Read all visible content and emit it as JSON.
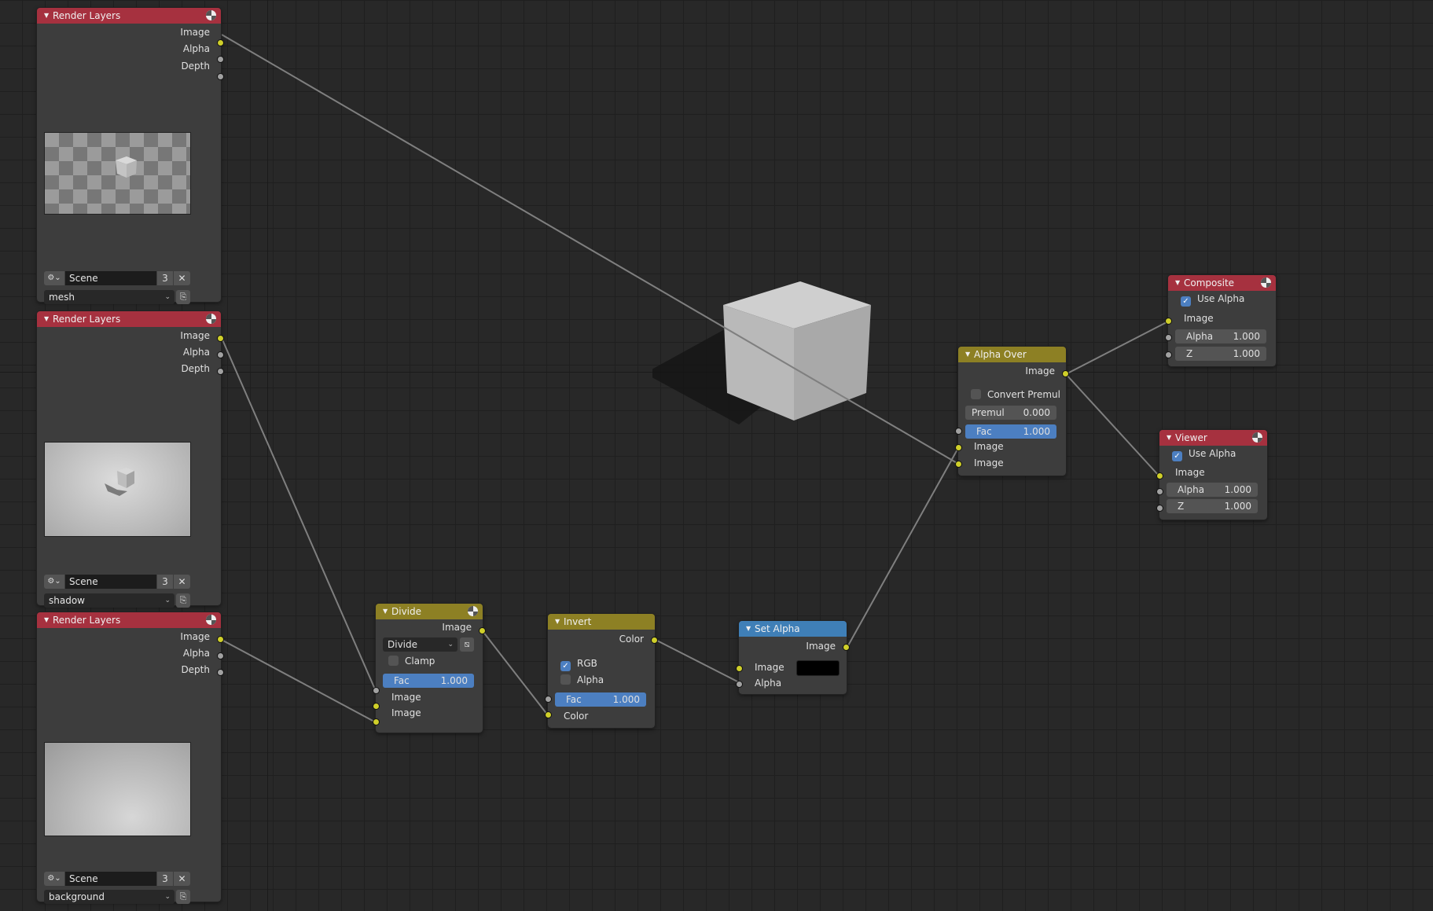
{
  "nodes": {
    "render_layers_mesh": {
      "title": "Render Layers",
      "outputs": [
        "Image",
        "Alpha",
        "Depth"
      ],
      "scene": "Scene",
      "scene_users": "3",
      "layer": "mesh"
    },
    "render_layers_shadow": {
      "title": "Render Layers",
      "outputs": [
        "Image",
        "Alpha",
        "Depth"
      ],
      "scene": "Scene",
      "scene_users": "3",
      "layer": "shadow"
    },
    "render_layers_background": {
      "title": "Render Layers",
      "outputs": [
        "Image",
        "Alpha",
        "Depth"
      ],
      "scene": "Scene",
      "scene_users": "3",
      "layer": "background"
    },
    "divide": {
      "title": "Divide",
      "output": "Image",
      "operation": "Divide",
      "clamp_label": "Clamp",
      "fac_label": "Fac",
      "fac_value": "1.000",
      "inputs": [
        "Image",
        "Image"
      ]
    },
    "invert": {
      "title": "Invert",
      "output": "Color",
      "rgb_label": "RGB",
      "alpha_label": "Alpha",
      "fac_label": "Fac",
      "fac_value": "1.000",
      "input": "Color"
    },
    "set_alpha": {
      "title": "Set Alpha",
      "output": "Image",
      "inputs": [
        "Image",
        "Alpha"
      ],
      "color_value": "#000000"
    },
    "alpha_over": {
      "title": "Alpha Over",
      "output": "Image",
      "convert_premul_label": "Convert Premul",
      "premul_label": "Premul",
      "premul_value": "0.000",
      "fac_label": "Fac",
      "fac_value": "1.000",
      "inputs": [
        "Image",
        "Image"
      ]
    },
    "composite": {
      "title": "Composite",
      "use_alpha_label": "Use Alpha",
      "input": "Image",
      "alpha_label": "Alpha",
      "alpha_value": "1.000",
      "z_label": "Z",
      "z_value": "1.000"
    },
    "viewer": {
      "title": "Viewer",
      "use_alpha_label": "Use Alpha",
      "input": "Image",
      "alpha_label": "Alpha",
      "alpha_value": "1.000",
      "z_label": "Z",
      "z_value": "1.000"
    }
  },
  "colors": {
    "input_output_header": "#a6313f",
    "converter_header": "#8d8024",
    "matte_header": "#3f7fb7",
    "socket_image": "#cfcf2a",
    "socket_value": "#a1a1a1",
    "field_highlight": "#4c7fc1"
  },
  "icons": {
    "node_group_icon": "render-sphere-icon",
    "collapse": "triangle-down-icon",
    "scene_browse": "scene-browse-icon",
    "unlink": "close-icon",
    "layer_browse": "layer-browse-icon",
    "divide_option": "image-icon"
  }
}
